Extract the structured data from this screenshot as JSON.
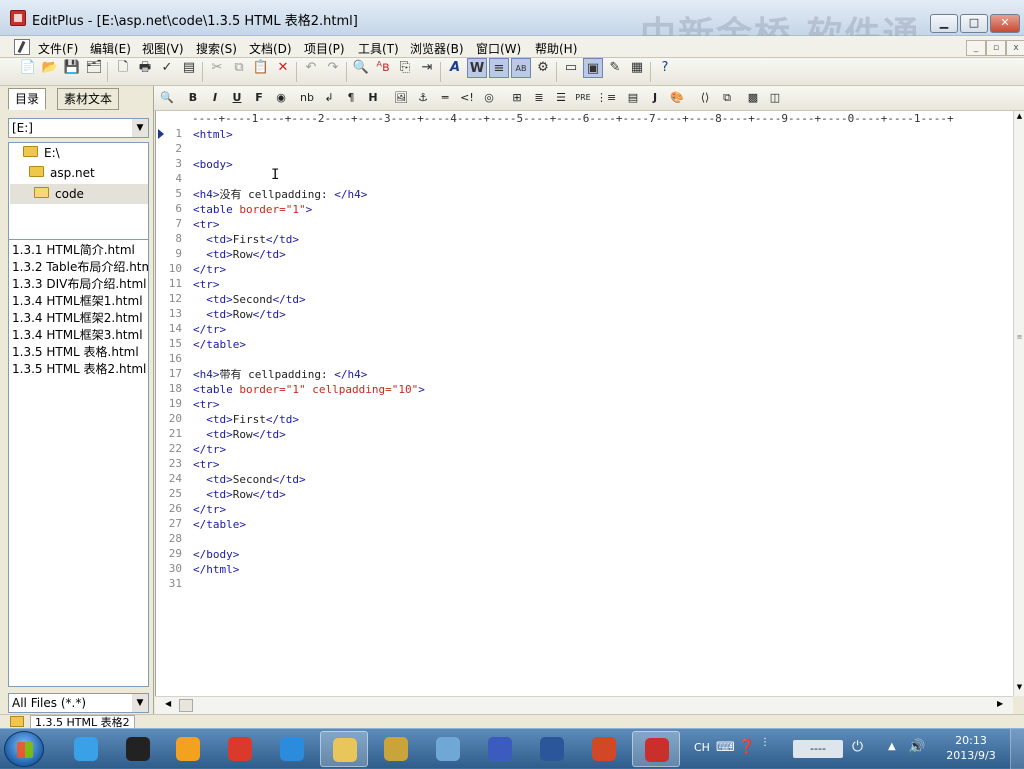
{
  "window": {
    "title": "EditPlus - [E:\\asp.net\\code\\1.3.5 HTML 表格2.html]",
    "watermark": "中新金桥 软件通"
  },
  "menu": [
    "文件(F)",
    "编辑(E)",
    "视图(V)",
    "搜索(S)",
    "文档(D)",
    "项目(P)",
    "工具(T)",
    "浏览器(B)",
    "窗口(W)",
    "帮助(H)"
  ],
  "left_panel": {
    "tabs": [
      "目录",
      "素材文本"
    ],
    "drive": "[E:]",
    "tree": [
      "E:\\",
      "asp.net",
      "code"
    ],
    "files": [
      "1.3.1 HTML简介.html",
      "1.3.2 Table布局介绍.html",
      "1.3.3 DIV布局介绍.html",
      "1.3.4 HTML框架1.html",
      "1.3.4 HTML框架2.html",
      "1.3.4 HTML框架3.html",
      "1.3.5 HTML 表格.html",
      "1.3.5 HTML 表格2.html"
    ],
    "filter": "All Files (*.*)"
  },
  "editor": {
    "ruler": "----+----1----+----2----+----3----+----4----+----5----+----6----+----7----+----8----+----9----+----0----+----1----+",
    "current_line": 1,
    "lines": [
      "<html>",
      "",
      "<body>",
      "",
      "<h4>没有 cellpadding: </h4>",
      "<table border=\"1\">",
      "<tr>",
      "  <td>First</td>",
      "  <td>Row</td>",
      "</tr>",
      "<tr>",
      "  <td>Second</td>",
      "  <td>Row</td>",
      "</tr>",
      "</table>",
      "",
      "<h4>带有 cellpadding: </h4>",
      "<table border=\"1\" cellpadding=\"10\">",
      "<tr>",
      "  <td>First</td>",
      "  <td>Row</td>",
      "</tr>",
      "<tr>",
      "  <td>Second</td>",
      "  <td>Row</td>",
      "</tr>",
      "</table>",
      "",
      "</body>",
      "</html>",
      ""
    ]
  },
  "statusbar": {
    "doc_tab": "1.3.5 HTML 表格2"
  },
  "taskbar": {
    "apps": [
      {
        "name": "bird-app-icon",
        "color": "#3aa0e8"
      },
      {
        "name": "qq-icon",
        "color": "#222222"
      },
      {
        "name": "gift-icon",
        "color": "#f2a21e"
      },
      {
        "name": "chrome-icon",
        "color": "#d93a2b"
      },
      {
        "name": "ie-icon",
        "color": "#2b8bdc"
      },
      {
        "name": "explorer-icon",
        "color": "#e8c65a",
        "active": true
      },
      {
        "name": "tools-icon",
        "color": "#c9a43a"
      },
      {
        "name": "globe-icon",
        "color": "#6fa8d6"
      },
      {
        "name": "infinity-icon",
        "color": "#3b5bbf"
      },
      {
        "name": "word-icon",
        "color": "#2b579a"
      },
      {
        "name": "powerpoint-icon",
        "color": "#d24726"
      },
      {
        "name": "editplus-icon",
        "color": "#c9302c",
        "active": true
      }
    ],
    "ime": "CH",
    "ime_mode": "----",
    "time": "20:13",
    "date": "2013/9/3"
  }
}
